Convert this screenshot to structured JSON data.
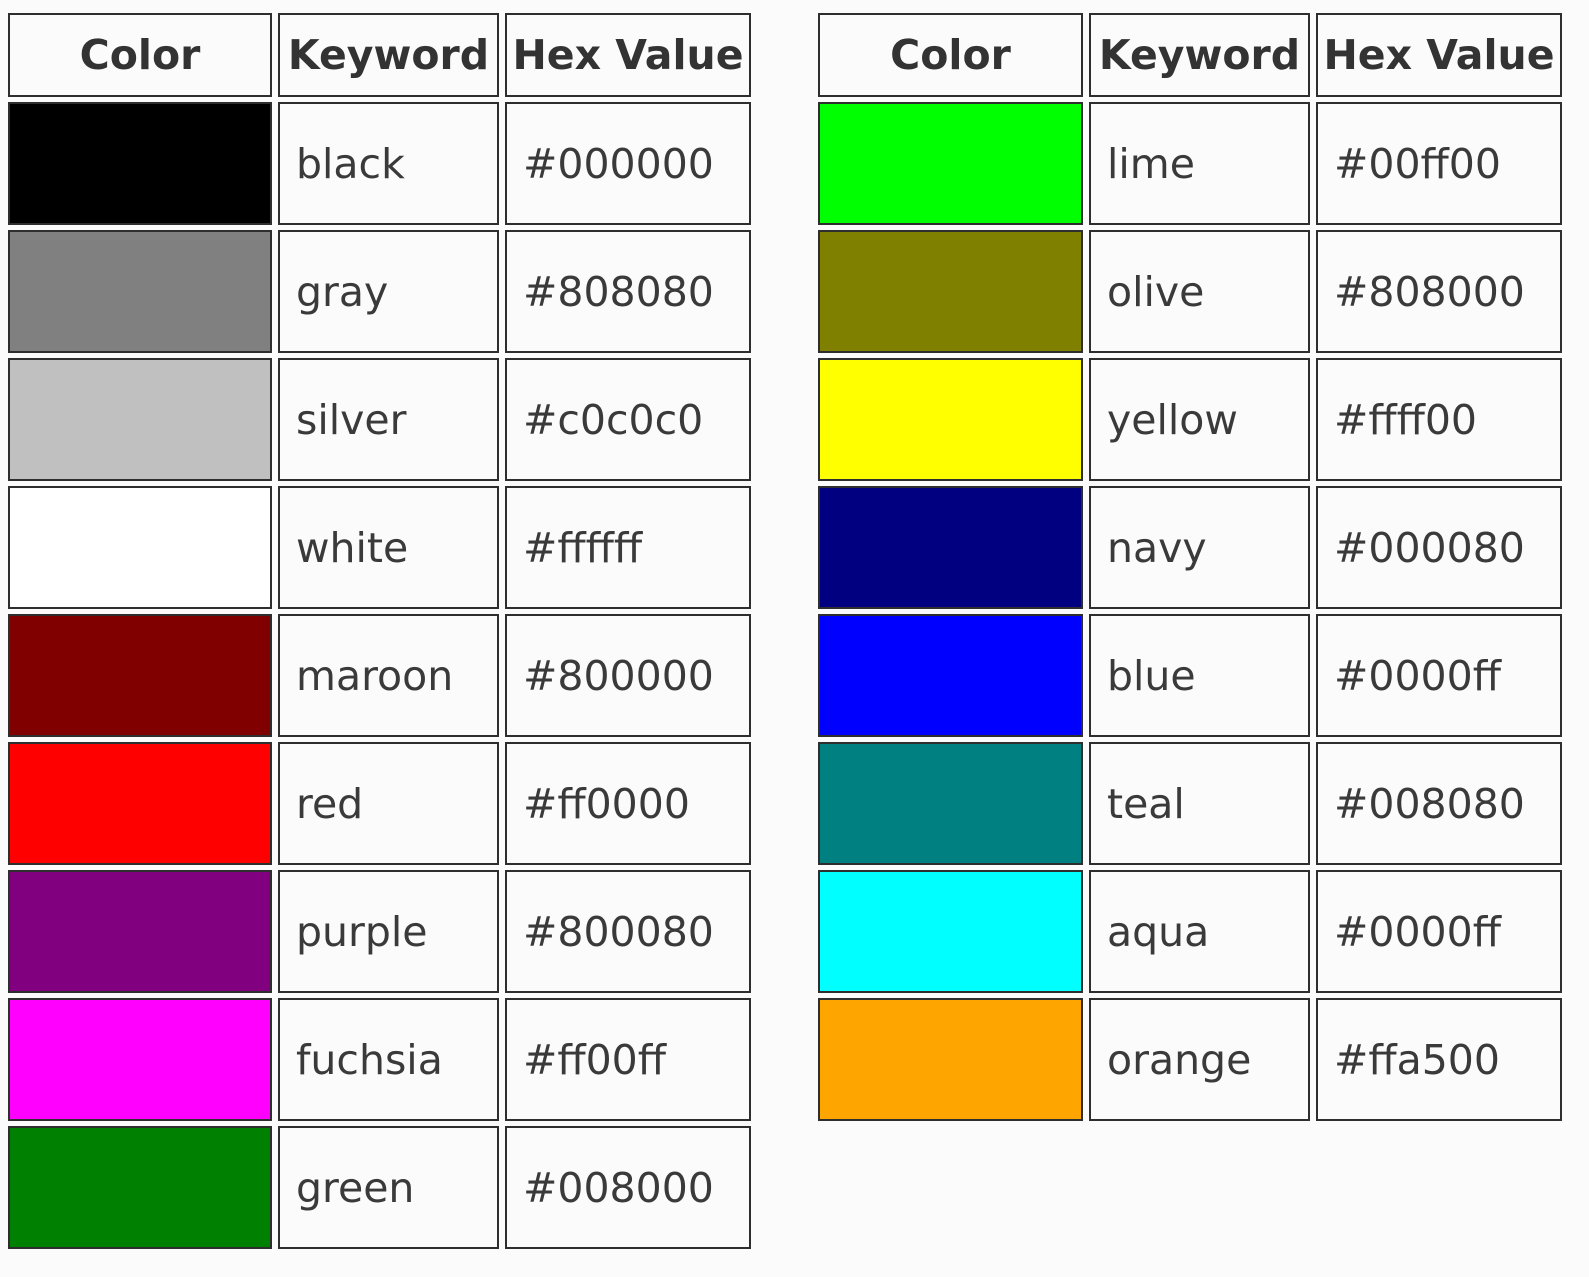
{
  "header": {
    "color": "Color",
    "keyword": "Keyword",
    "hex": "Hex Value"
  },
  "tables": [
    {
      "rows": [
        {
          "keyword": "black",
          "hex": "#000000",
          "swatch": "#000000"
        },
        {
          "keyword": "gray",
          "hex": "#808080",
          "swatch": "#808080"
        },
        {
          "keyword": "silver",
          "hex": "#c0c0c0",
          "swatch": "#c0c0c0"
        },
        {
          "keyword": "white",
          "hex": "#ffffff",
          "swatch": "#ffffff"
        },
        {
          "keyword": "maroon",
          "hex": "#800000",
          "swatch": "#800000"
        },
        {
          "keyword": "red",
          "hex": "#ff0000",
          "swatch": "#ff0000"
        },
        {
          "keyword": "purple",
          "hex": "#800080",
          "swatch": "#800080"
        },
        {
          "keyword": "fuchsia",
          "hex": "#ff00ff",
          "swatch": "#ff00ff"
        },
        {
          "keyword": "green",
          "hex": "#008000",
          "swatch": "#008000"
        }
      ]
    },
    {
      "rows": [
        {
          "keyword": "lime",
          "hex": "#00ff00",
          "swatch": "#00ff00"
        },
        {
          "keyword": "olive",
          "hex": "#808000",
          "swatch": "#808000"
        },
        {
          "keyword": "yellow",
          "hex": "#ffff00",
          "swatch": "#ffff00"
        },
        {
          "keyword": "navy",
          "hex": "#000080",
          "swatch": "#000080"
        },
        {
          "keyword": "blue",
          "hex": "#0000ff",
          "swatch": "#0000ff"
        },
        {
          "keyword": "teal",
          "hex": "#008080",
          "swatch": "#008080"
        },
        {
          "keyword": "aqua",
          "hex": "#0000ff",
          "swatch": "#00ffff"
        },
        {
          "keyword": "orange",
          "hex": "#ffa500",
          "swatch": "#ffa500"
        }
      ]
    }
  ]
}
